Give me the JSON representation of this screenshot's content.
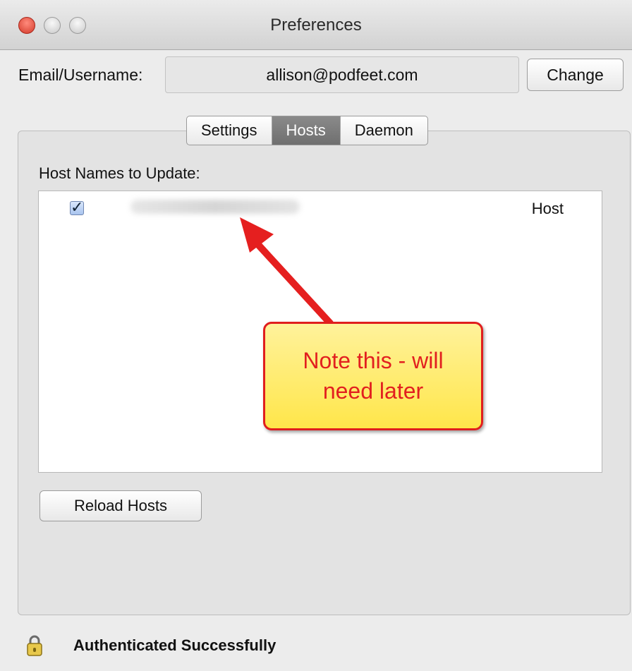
{
  "window": {
    "title": "Preferences"
  },
  "account": {
    "label": "Email/Username:",
    "value": "allison@podfeet.com",
    "change_label": "Change"
  },
  "tabs": [
    {
      "label": "Settings"
    },
    {
      "label": "Hosts"
    },
    {
      "label": "Daemon"
    }
  ],
  "hosts": {
    "heading": "Host Names to Update:",
    "rows": [
      {
        "type": "Host",
        "checked": true
      }
    ],
    "reload_label": "Reload Hosts"
  },
  "status": {
    "text": "Authenticated Successfully"
  },
  "annotation": {
    "text": "Note this - will need later"
  },
  "colors": {
    "annotation_fill": "#ffe64a",
    "annotation_text": "#e21f1f",
    "arrow": "#e51f1f"
  },
  "icons": {
    "status": "lock-icon",
    "checkbox": "checkmark-icon"
  }
}
